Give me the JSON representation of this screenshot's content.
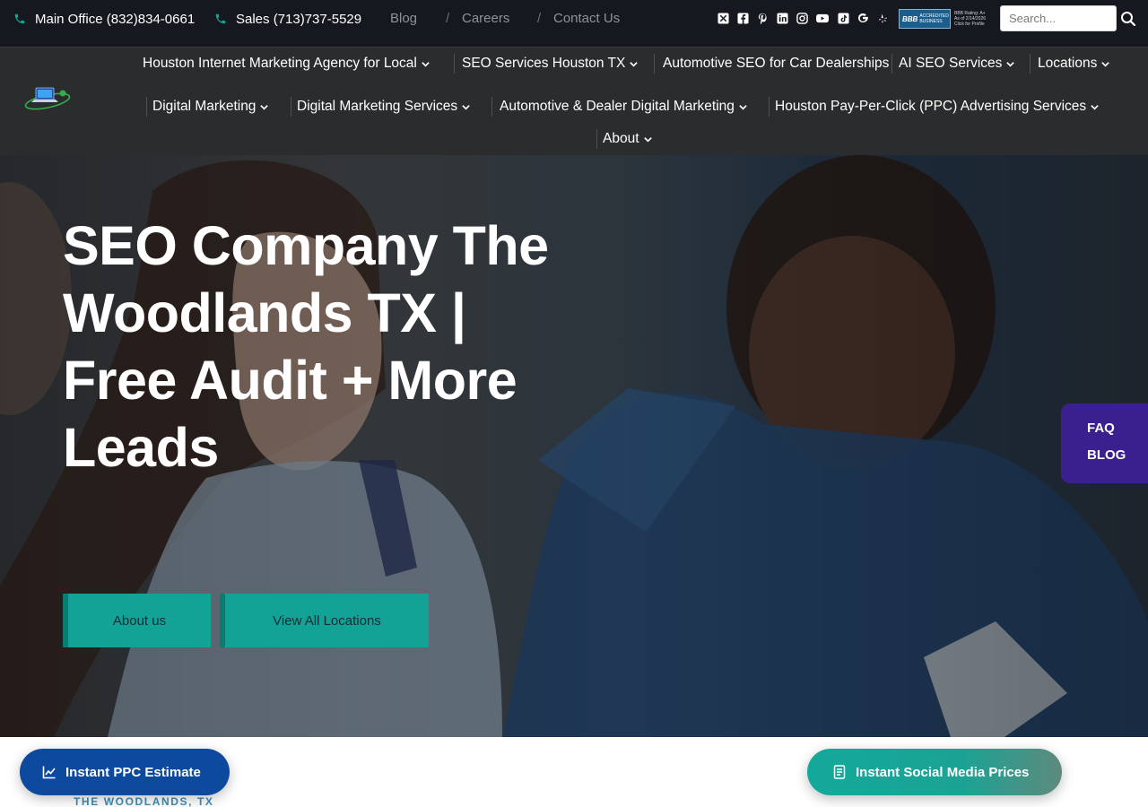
{
  "topbar": {
    "main_office": "Main Office (832)834-0661",
    "sales": "Sales (713)737-5529",
    "links": [
      "Blog",
      "Careers",
      "Contact Us"
    ],
    "separator": "/",
    "social_icons": [
      "x-icon",
      "facebook-icon",
      "pinterest-icon",
      "linkedin-icon",
      "instagram-icon",
      "youtube-icon",
      "tiktok-icon",
      "google-icon",
      "yelp-icon"
    ],
    "bbb": {
      "seal_b": "BBB",
      "seal_text1": "ACCREDITED",
      "seal_text2": "BUSINESS",
      "rating_line1": "BBB Rating: A+",
      "rating_line2": "As of 2/14/2026",
      "rating_line3": "Click for Profile"
    },
    "search_placeholder": "Search..."
  },
  "nav": {
    "row1": [
      "Houston Internet Marketing Agency for Local",
      "SEO Services Houston TX",
      "Automotive SEO for Car Dealerships",
      "AI SEO Services",
      "Locations"
    ],
    "row2": [
      "Digital Marketing",
      "Digital Marketing Services",
      "Automotive & Dealer Digital Marketing",
      "Houston Pay-Per-Click (PPC) Advertising Services"
    ],
    "row3": [
      "About"
    ]
  },
  "hero": {
    "title_lines": [
      "SEO Company The",
      "Woodlands TX |",
      "Free Audit + More",
      "Leads"
    ],
    "btn_about": "About us",
    "btn_locations": "View All Locations"
  },
  "side_tab": {
    "faq": "FAQ",
    "blog": "BLOG"
  },
  "float": {
    "ppc": "Instant PPC Estimate",
    "social": "Instant Social Media Prices"
  },
  "crumb": "THE WOODLANDS, TX",
  "colors": {
    "topbar_bg": "#15181e",
    "nav_bg": "#2b2c2e",
    "teal": "#12a396",
    "side_tab": "#3a1f8f",
    "ppc_blue": "#0d4a9e",
    "phone_icon": "#12a396"
  }
}
